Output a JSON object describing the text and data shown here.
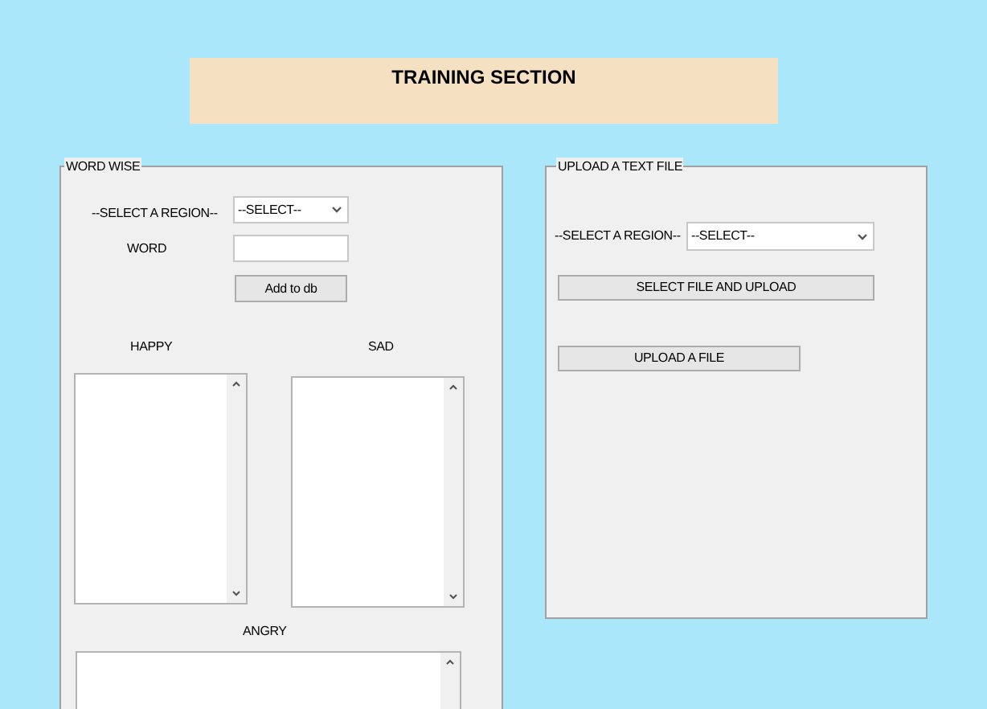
{
  "header": {
    "title": "TRAINING SECTION"
  },
  "word_wise": {
    "title": "WORD WISE",
    "region_label": "--SELECT A REGION--",
    "region_select": {
      "value": "--SELECT--"
    },
    "word_label": "WORD",
    "add_button": "Add to db",
    "lists": [
      {
        "label": "HAPPY"
      },
      {
        "label": "SAD"
      },
      {
        "label": "ANGRY"
      }
    ]
  },
  "upload": {
    "title": "UPLOAD A TEXT FILE",
    "region_label": "--SELECT A REGION--",
    "region_select": {
      "value": "--SELECT--"
    },
    "buttons": [
      "SELECT FILE AND UPLOAD",
      "UPLOAD A FILE"
    ]
  }
}
